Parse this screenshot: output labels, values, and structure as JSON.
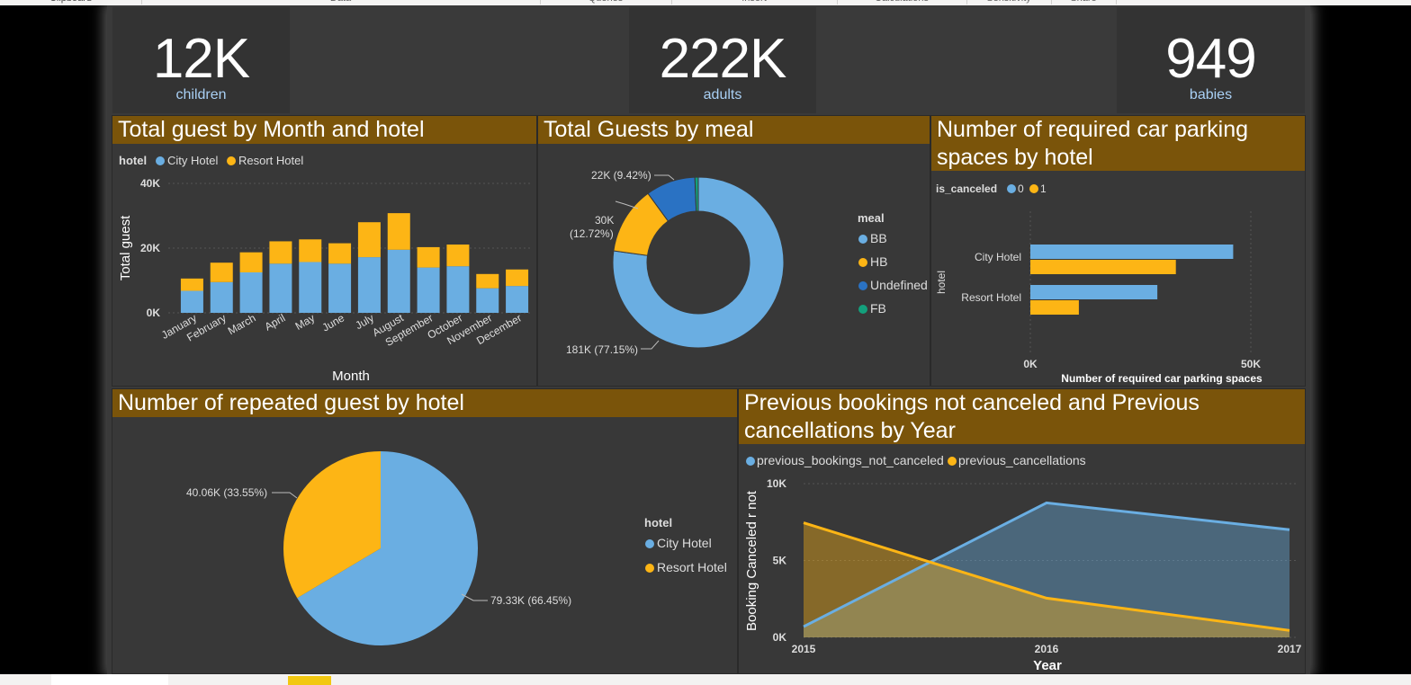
{
  "kpis": [
    {
      "value": "12K",
      "label": "children"
    },
    {
      "value": "222K",
      "label": "adults"
    },
    {
      "value": "949",
      "label": "babies"
    }
  ],
  "ribbon_groups": [
    "Clipboard",
    "Data",
    "Queries",
    "Insert",
    "Calculations",
    "Sensitivity",
    "Share"
  ],
  "colors": {
    "blue": "#6aaee2",
    "orange": "#fdb515",
    "title_bg": "#7a540a",
    "dark_blue": "#2a72c3",
    "teal": "#13a07c"
  },
  "panels": {
    "guest_month": {
      "title": "Total guest by Month and hotel",
      "legend_title": "hotel",
      "legend_items": [
        "City Hotel",
        "Resort Hotel"
      ],
      "ylabel": "Total guest",
      "xlabel": "Month"
    },
    "meal": {
      "title": "Total Guests by meal",
      "legend_title": "meal",
      "legend_items": [
        "BB",
        "HB",
        "Undefined",
        "FB"
      ],
      "labels": [
        "181K (77.15%)",
        "30K (12.72%)",
        "22K (9.42%)"
      ]
    },
    "parking": {
      "title_line1": "Number of required car parking",
      "title_line2": "spaces by hotel",
      "legend_title": "is_canceled",
      "legend_items": [
        "0",
        "1"
      ],
      "ylabel": "hotel",
      "xlabel": "Number of required car parking spaces"
    },
    "repeated": {
      "title": "Number of repeated guest by hotel",
      "legend_title": "hotel",
      "legend_items": [
        "City Hotel",
        "Resort Hotel"
      ],
      "labels": [
        "79.33K (66.45%)",
        "40.06K (33.55%)"
      ]
    },
    "prev": {
      "title_line1": "Previous bookings not canceled and Previous",
      "title_line2": "cancellations by Year",
      "legend_items": [
        "previous_bookings_not_canceled",
        "previous_cancellations"
      ],
      "ylabel": "Booking Canceled r not",
      "xlabel": "Year"
    }
  },
  "chart_data": [
    {
      "type": "bar",
      "stacked": true,
      "title": "Total guest by Month and hotel",
      "xlabel": "Month",
      "ylabel": "Total guest",
      "ylim": [
        0,
        40000
      ],
      "yticks": [
        "0K",
        "20K",
        "40K"
      ],
      "categories": [
        "January",
        "February",
        "March",
        "April",
        "May",
        "June",
        "July",
        "August",
        "September",
        "October",
        "November",
        "December"
      ],
      "series": [
        {
          "name": "City Hotel",
          "values": [
            6800,
            9500,
            12500,
            15200,
            15700,
            15200,
            17200,
            19500,
            14000,
            14400,
            7600,
            8300
          ]
        },
        {
          "name": "Resort Hotel",
          "values": [
            3800,
            6000,
            6200,
            6900,
            7000,
            6300,
            10800,
            11300,
            6300,
            6700,
            4400,
            5100
          ]
        }
      ]
    },
    {
      "type": "pie",
      "title": "Total Guests by meal",
      "donut": true,
      "categories": [
        "BB",
        "HB",
        "Undefined",
        "FB"
      ],
      "values": [
        181000,
        30000,
        22000,
        1500
      ]
    },
    {
      "type": "bar",
      "orientation": "horizontal",
      "title": "Number of required car parking spaces by hotel",
      "xlabel": "Number of required car parking spaces",
      "ylabel": "hotel",
      "categories": [
        "City Hotel",
        "Resort Hotel"
      ],
      "xlim": [
        0,
        50000
      ],
      "xticks": [
        "0K",
        "50K"
      ],
      "series": [
        {
          "name": "0",
          "values": [
            46000,
            28800
          ]
        },
        {
          "name": "1",
          "values": [
            33000,
            11000
          ]
        }
      ]
    },
    {
      "type": "pie",
      "title": "Number of repeated guest by hotel",
      "categories": [
        "City Hotel",
        "Resort Hotel"
      ],
      "values": [
        79330,
        40060
      ]
    },
    {
      "type": "area",
      "title": "Previous bookings not canceled and Previous cancellations by Year",
      "xlabel": "Year",
      "ylabel": "Booking Canceled r not",
      "x": [
        "2015",
        "2016",
        "2017"
      ],
      "ylim": [
        0,
        10000
      ],
      "yticks": [
        "0K",
        "5K",
        "10K"
      ],
      "series": [
        {
          "name": "previous_bookings_not_canceled",
          "values": [
            700,
            8750,
            7000
          ]
        },
        {
          "name": "previous_cancellations",
          "values": [
            7450,
            2550,
            450
          ]
        }
      ]
    }
  ]
}
